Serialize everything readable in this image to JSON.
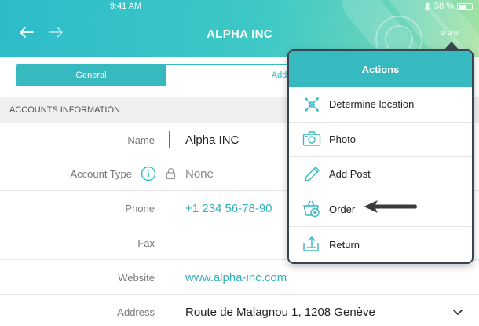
{
  "status_bar": {
    "time": "9:41 AM",
    "battery": "58 %"
  },
  "header": {
    "title": "ALPHA INC"
  },
  "tabs": [
    {
      "label": "General",
      "active": true
    },
    {
      "label": "Address Information",
      "active": false
    }
  ],
  "section": {
    "title": "ACCOUNTS INFORMATION"
  },
  "fields": [
    {
      "label": "Name",
      "value": "Alpha INC",
      "required": true
    },
    {
      "label": "Account Type",
      "value": "None"
    },
    {
      "label": "Phone",
      "value": "+1 234 56-78-90"
    },
    {
      "label": "Fax",
      "value": ""
    },
    {
      "label": "Website",
      "value": "www.alpha-inc.com"
    },
    {
      "label": "Address",
      "value": "Route de Malagnou 1, 1208 Genève"
    }
  ],
  "actions": {
    "title": "Actions",
    "items": [
      {
        "label": "Determine location",
        "icon": "location-icon"
      },
      {
        "label": "Photo",
        "icon": "camera-icon"
      },
      {
        "label": "Add Post",
        "icon": "pencil-icon"
      },
      {
        "label": "Order",
        "icon": "basket-add-icon"
      },
      {
        "label": "Return",
        "icon": "return-icon"
      }
    ]
  },
  "colors": {
    "accent": "#36b9bf",
    "link": "#2fb0b8",
    "required": "#e8373e",
    "popover_border": "#384552"
  }
}
